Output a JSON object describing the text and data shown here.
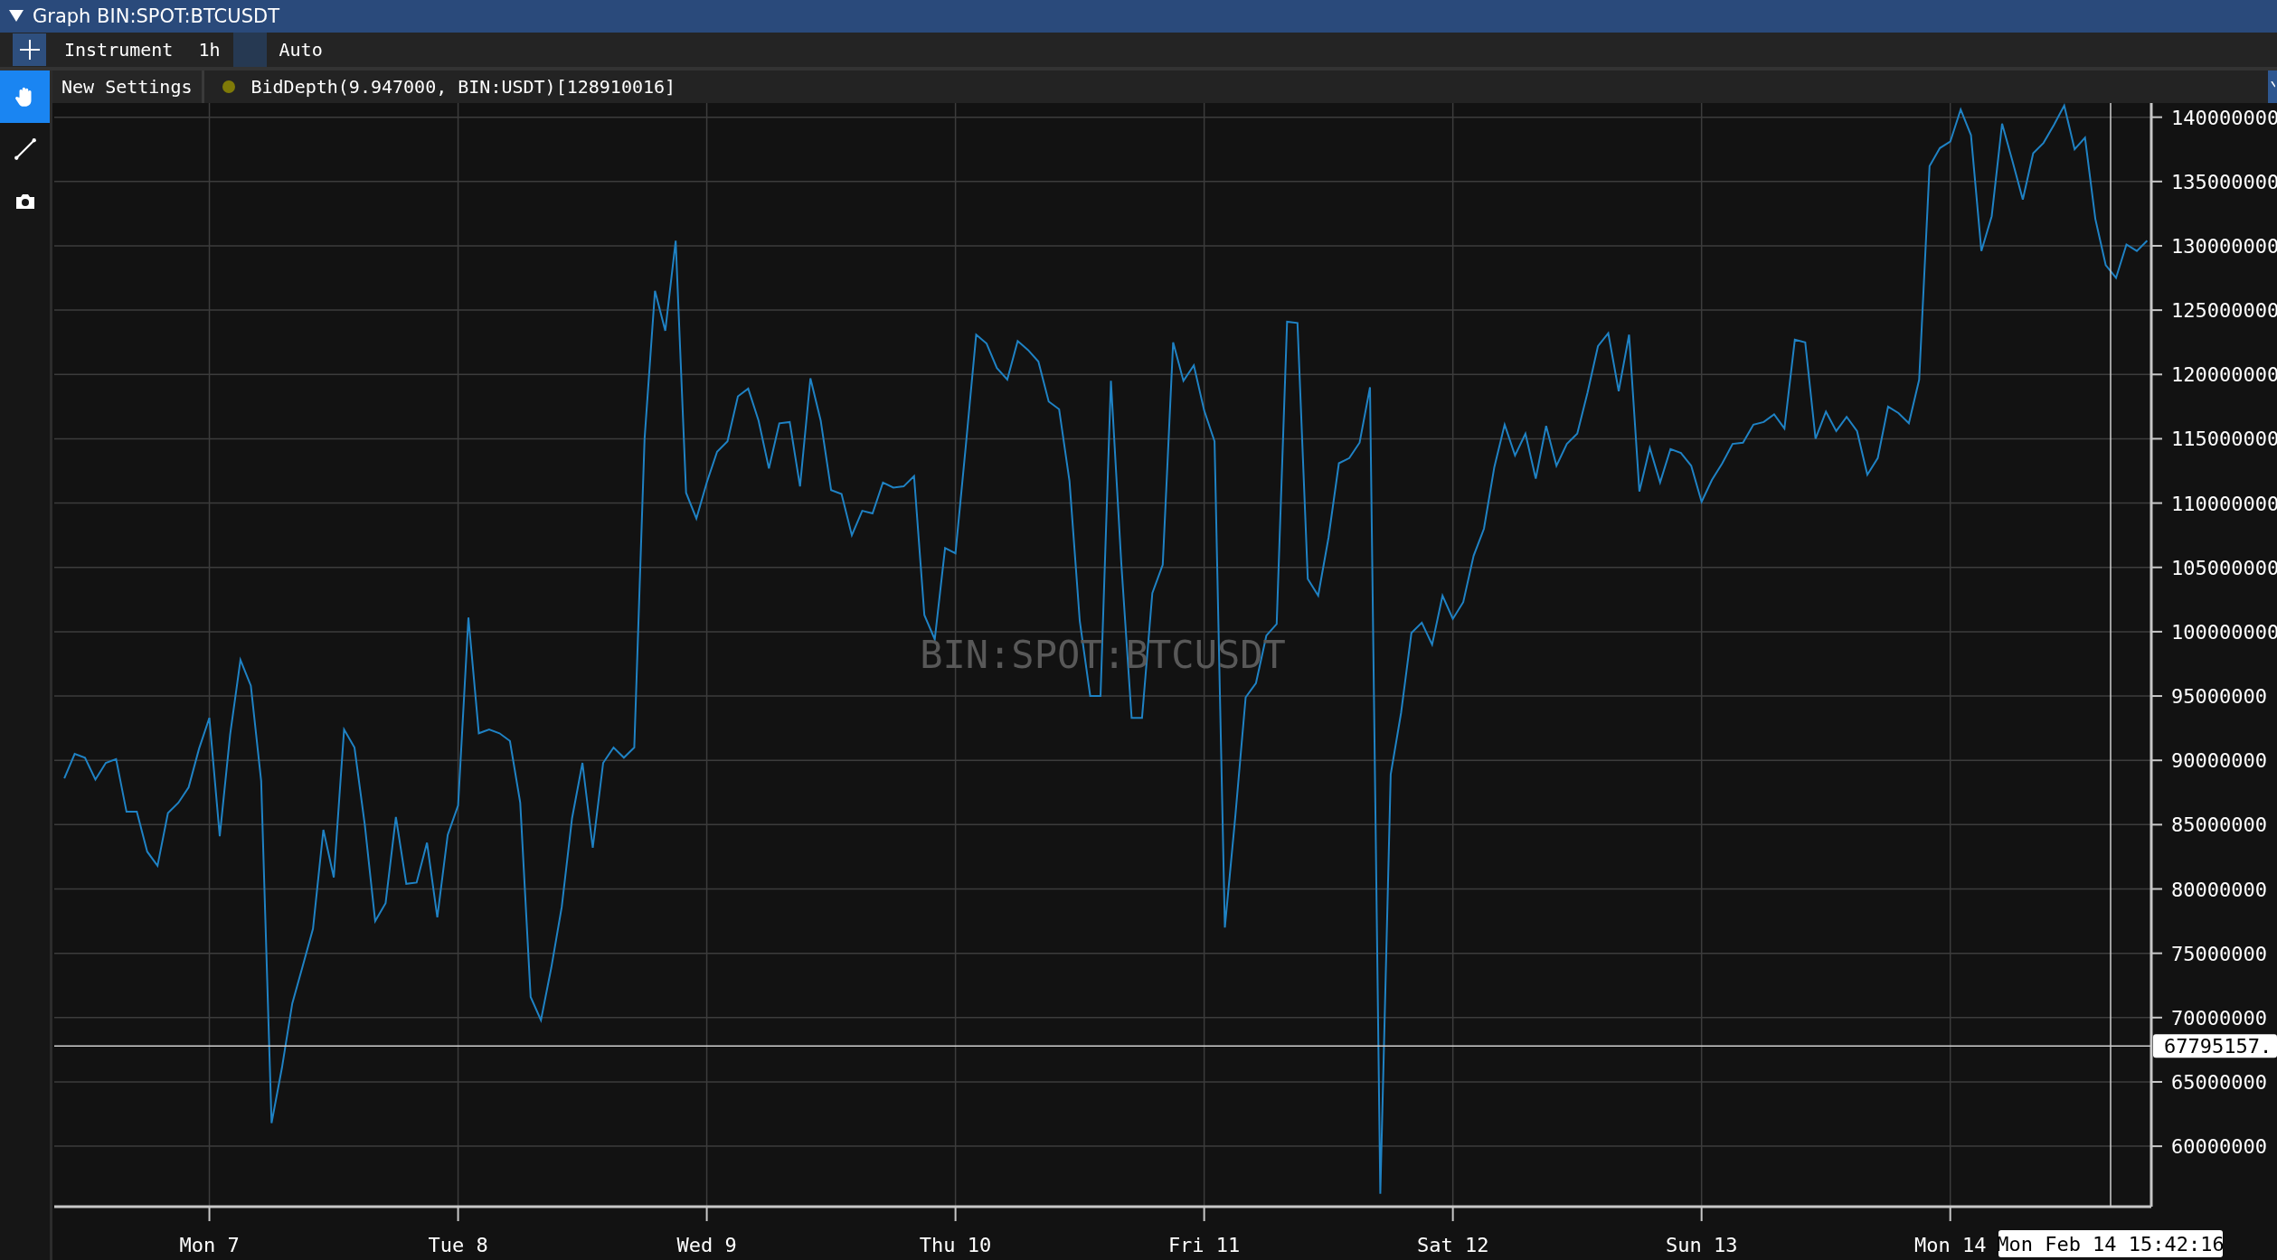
{
  "window": {
    "title": "Graph BIN:SPOT:BTCUSDT",
    "expanded": true
  },
  "toolbar": {
    "items": [
      {
        "kind": "add"
      },
      {
        "kind": "text",
        "label": "Instrument"
      },
      {
        "kind": "text",
        "label": "1h"
      },
      {
        "kind": "swatch"
      },
      {
        "kind": "text",
        "label": "Auto"
      }
    ]
  },
  "tools": [
    {
      "kind": "hand",
      "selected": true
    },
    {
      "kind": "line",
      "selected": false
    },
    {
      "kind": "camera",
      "selected": false
    }
  ],
  "legend": {
    "settings_button": "New Settings",
    "series": [
      {
        "label": "BidDepth(9.947000, BIN:USDT)[128910016]",
        "color": "#7f7a08"
      }
    ]
  },
  "chart": {
    "watermark": "BIN:SPOT:BTCUSDT",
    "chart_data": {
      "type": "line",
      "categories": [
        null,
        null,
        null,
        null,
        null,
        null,
        null,
        null,
        null,
        null,
        null,
        null,
        null,
        null,
        "Mon 7",
        null,
        null,
        null,
        null,
        null,
        null,
        null,
        null,
        null,
        null,
        null,
        null,
        null,
        null,
        null,
        null,
        null,
        null,
        null,
        null,
        null,
        null,
        null,
        "Tue 8",
        null,
        null,
        null,
        null,
        null,
        null,
        null,
        null,
        null,
        null,
        null,
        null,
        null,
        null,
        null,
        null,
        null,
        null,
        null,
        null,
        null,
        null,
        null,
        "Wed 9",
        null,
        null,
        null,
        null,
        null,
        null,
        null,
        null,
        null,
        null,
        null,
        null,
        null,
        null,
        null,
        null,
        null,
        null,
        null,
        null,
        null,
        null,
        null,
        "Thu 10",
        null,
        null,
        null,
        null,
        null,
        null,
        null,
        null,
        null,
        null,
        null,
        null,
        null,
        null,
        null,
        null,
        null,
        null,
        null,
        null,
        null,
        null,
        null,
        "Fri 11",
        null,
        null,
        null,
        null,
        null,
        null,
        null,
        null,
        null,
        null,
        null,
        null,
        null,
        null,
        null,
        null,
        null,
        null,
        null,
        null,
        null,
        null,
        null,
        "Sat 12",
        null,
        null,
        null,
        null,
        null,
        null,
        null,
        null,
        null,
        null,
        null,
        null,
        null,
        null,
        null,
        null,
        null,
        null,
        null,
        null,
        null,
        null,
        null,
        "Sun 13",
        null,
        null,
        null,
        null,
        null,
        null,
        null,
        null,
        null,
        null,
        null,
        null,
        null,
        null,
        null,
        null,
        null,
        null,
        null,
        null,
        null,
        null,
        null,
        "Mon 14",
        null,
        null,
        null,
        null,
        null,
        null,
        null,
        null,
        null,
        null,
        null,
        null,
        null,
        null,
        null,
        null,
        null,
        null,
        null
      ],
      "series": [
        {
          "color": "#1f82c4",
          "values": [
            88600000,
            90500000,
            90200000,
            88500000,
            89800000,
            90100000,
            86000000,
            86000000,
            82900000,
            81800000,
            85900000,
            86700000,
            87900000,
            90900000,
            93300000,
            84100000,
            92000000,
            97800000,
            95800000,
            88400000,
            61800000,
            66100000,
            71100000,
            74000000,
            76900000,
            84600000,
            80900000,
            92400000,
            91000000,
            85000000,
            77500000,
            78900000,
            85600000,
            80400000,
            80500000,
            83600000,
            77800000,
            84200000,
            86500000,
            101100000,
            92100000,
            92400000,
            92100000,
            91500000,
            86700000,
            71600000,
            69800000,
            73900000,
            78600000,
            85500000,
            89800000,
            83200000,
            89800000,
            91000000,
            90200000,
            91000000,
            115000000,
            126500000,
            123400000,
            130400000,
            110800000,
            108800000,
            111600000,
            114000000,
            114800000,
            118300000,
            118900000,
            116400000,
            112700000,
            116200000,
            116300000,
            111300000,
            119700000,
            116400000,
            111000000,
            110700000,
            107500000,
            109400000,
            109200000,
            111600000,
            111200000,
            111300000,
            112100000,
            101300000,
            99400000,
            106500000,
            106100000,
            114500000,
            123100000,
            122400000,
            120500000,
            119600000,
            122600000,
            121900000,
            121000000,
            117900000,
            117300000,
            111700000,
            100800000,
            95000000,
            95000000,
            119500000,
            105300000,
            93300000,
            93300000,
            103000000,
            105200000,
            122500000,
            119500000,
            120700000,
            117200000,
            114800000,
            77000000,
            85600000,
            94900000,
            96000000,
            99700000,
            100600000,
            124100000,
            124000000,
            104100000,
            102800000,
            107300000,
            113100000,
            113500000,
            114700000,
            119000000,
            56300000,
            88900000,
            93700000,
            99900000,
            100700000,
            99000000,
            102800000,
            101000000,
            102300000,
            105900000,
            108000000,
            112800000,
            116100000,
            113700000,
            115400000,
            111900000,
            116000000,
            112900000,
            114600000,
            115400000,
            118600000,
            122200000,
            123200000,
            118700000,
            123100000,
            110900000,
            114300000,
            111600000,
            114200000,
            113900000,
            112900000,
            110100000,
            111800000,
            113100000,
            114600000,
            114700000,
            116100000,
            116300000,
            116900000,
            115800000,
            122700000,
            122500000,
            115000000,
            117100000,
            115600000,
            116700000,
            115600000,
            112200000,
            113500000,
            117500000,
            117000000,
            116200000,
            119600000,
            136200000,
            137600000,
            138100000,
            140600000,
            138600000,
            129600000,
            132300000,
            139500000,
            136600000,
            133600000,
            137200000,
            138000000,
            139400000,
            140900000,
            137500000,
            138400000,
            132100000,
            128500000,
            127500000,
            130100000,
            129600000,
            130400000
          ]
        }
      ],
      "ylim": [
        55300000,
        141100000
      ],
      "yticks": [
        60000000,
        65000000,
        70000000,
        75000000,
        80000000,
        85000000,
        90000000,
        95000000,
        100000000,
        105000000,
        110000000,
        115000000,
        120000000,
        125000000,
        130000000,
        135000000,
        140000000
      ],
      "grid": true,
      "ref_lines": [
        {
          "axis": "y",
          "value": 67795157,
          "label": "67795157."
        }
      ]
    },
    "crosshair": {
      "time_label": "Mon Feb 14 15:42:16"
    }
  }
}
